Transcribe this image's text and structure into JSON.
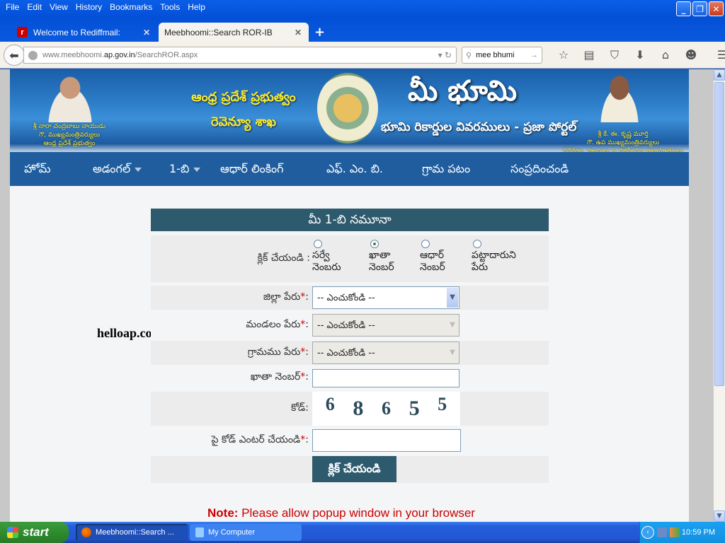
{
  "browser": {
    "menu": [
      "File",
      "Edit",
      "View",
      "History",
      "Bookmarks",
      "Tools",
      "Help"
    ],
    "tabs": [
      {
        "label": "Welcome to Rediffmail:",
        "active": false,
        "icon": "rediff-icon"
      },
      {
        "label": "Meebhoomi::Search ROR-IB",
        "active": true
      }
    ],
    "url_prefix": "www.meebhoomi.",
    "url_domain": "ap.gov.in",
    "url_path": "/SearchROR.aspx",
    "search_value": "mee bhumi",
    "toolbar_icons": [
      "star-icon",
      "reading-list-icon",
      "pocket-icon",
      "download-icon",
      "home-icon",
      "hello-icon",
      "menu-icon"
    ]
  },
  "banner": {
    "gov_line1": "ఆంధ్ర ప్రదేశ్ ప్రభుత్వం",
    "gov_line2": "రెవెన్యూ శాఖ",
    "title": "మీ భూమి",
    "subtitle": "భూమి రికార్డుల వివరములు - ప్రజా పోర్టల్",
    "left_caption": [
      "శ్రీ నారా చంద్రబాబు నాయుడు",
      "గౌ, ముఖ్యమంత్రివర్యులు",
      "ఆంధ్ర ప్రదేశ్ ప్రభుత్వం"
    ],
    "right_caption": [
      "శ్రీ కే. ఈ. కృష్ణ మూర్తి",
      "గౌ. ఉప ముఖ్యమంత్రివర్యులు",
      "రెవెన్యూ, స్టాంపులు & రిజిస్ట్రేషన్ల శాఖామాత్యులు"
    ]
  },
  "nav": [
    {
      "label": "హోమ్",
      "dropdown": false
    },
    {
      "label": "అడంగల్",
      "dropdown": true
    },
    {
      "label": "1-బి",
      "dropdown": true
    },
    {
      "label": "ఆధార్ లింకింగ్",
      "dropdown": false
    },
    {
      "label": "ఎఫ్. ఎం. బి.",
      "dropdown": false
    },
    {
      "label": "గ్రామ పటం",
      "dropdown": false
    },
    {
      "label": "సంప్రదించండి",
      "dropdown": false
    }
  ],
  "watermark": "helloap.com",
  "form": {
    "heading": "మీ 1-బి నమూనా",
    "radio_label": "క్లిక్ చేయండి :",
    "radios": [
      {
        "line1": "సర్వే",
        "line2": "నెంబరు",
        "checked": false
      },
      {
        "line1": "ఖాతా",
        "line2": "నెంబర్",
        "checked": true
      },
      {
        "line1": "ఆధార్",
        "line2": "నెంబర్",
        "checked": false
      },
      {
        "line1": "పట్టాదారుని",
        "line2": "పేరు",
        "checked": false
      }
    ],
    "district_label": "జిల్లా పేరు",
    "district_value": "-- ఎంచుకోండి --",
    "mandal_label": "మండలం పేరు",
    "mandal_value": "-- ఎంచుకోండి --",
    "village_label": "గ్రామము పేరు",
    "village_value": "-- ఎంచుకోండి --",
    "khata_label": "ఖాతా నెంబర్",
    "khata_value": "",
    "code_label": "కోడ్:",
    "captcha": [
      "6",
      "8",
      "6",
      "5",
      "5"
    ],
    "enter_code_label": "పై కోడ్ ఎంటర్ చేయండి",
    "enter_code_value": "",
    "required_mark": "*",
    "colon": ":",
    "submit": "క్లిక్ చేయండి"
  },
  "note_bold": "Note:",
  "note_text": " Please allow popup window in your browser",
  "taskbar": {
    "start": "start",
    "tasks": [
      {
        "label": "Meebhoomi::Search ...",
        "active": true
      },
      {
        "label": "My Computer",
        "active": false
      }
    ],
    "clock": "10:59 PM"
  },
  "colors": {
    "header": "#2e5a6e",
    "nav": "#1f5d9e",
    "note": "#cc0000"
  }
}
